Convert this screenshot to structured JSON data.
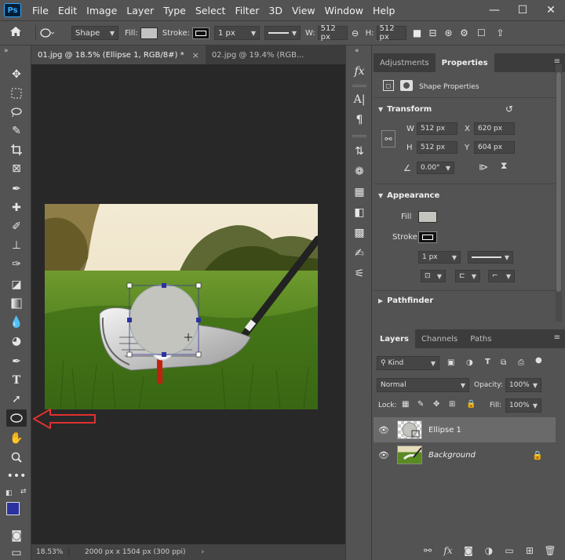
{
  "app": {
    "logo": "Ps"
  },
  "menu": [
    "File",
    "Edit",
    "Image",
    "Layer",
    "Type",
    "Select",
    "Filter",
    "3D",
    "View",
    "Window",
    "Help"
  ],
  "window_controls": [
    "—",
    "☐",
    "✕"
  ],
  "options": {
    "shape_mode": "Shape",
    "fill_label": "Fill:",
    "stroke_label": "Stroke:",
    "stroke_width": "1 px",
    "w_label": "W:",
    "w_value": "512 px",
    "h_label": "H:",
    "h_value": "512 px"
  },
  "tabs": [
    {
      "label": "01.jpg @ 18.5% (Ellipse 1, RGB/8#) *",
      "close": "×"
    },
    {
      "label": "02.jpg @ 19.4% (RGB...",
      "close": "×"
    }
  ],
  "status": {
    "zoom": "18.53%",
    "doc_info": "2000 px x 1504 px (300 ppi)",
    "arrow": "›"
  },
  "colors": {
    "foreground": "#2b32a0",
    "background": "#ffffff",
    "annotation": "#e03030",
    "shape_fill": "#c2c4bd"
  },
  "right": {
    "tabs": {
      "adjustments": "Adjustments",
      "properties": "Properties"
    },
    "shape_properties": "Shape Properties",
    "transform": {
      "title": "Transform",
      "w_label": "W",
      "w_value": "512 px",
      "x_label": "X",
      "x_value": "620 px",
      "h_label": "H",
      "h_value": "512 px",
      "y_label": "Y",
      "y_value": "604 px",
      "angle": "0.00°"
    },
    "appearance": {
      "title": "Appearance",
      "fill_label": "Fill",
      "stroke_label": "Stroke",
      "stroke_width": "1 px"
    },
    "pathfinder": {
      "title": "Pathfinder"
    },
    "layers": {
      "tabs": {
        "layers": "Layers",
        "channels": "Channels",
        "paths": "Paths"
      },
      "filter": "Kind",
      "blend_mode": "Normal",
      "opacity_label": "Opacity:",
      "opacity_value": "100%",
      "lock_label": "Lock:",
      "fill_label": "Fill:",
      "fill_value": "100%",
      "items": [
        {
          "name": "Ellipse 1",
          "selected": true
        },
        {
          "name": "Background",
          "selected": false,
          "locked": true
        }
      ]
    }
  }
}
